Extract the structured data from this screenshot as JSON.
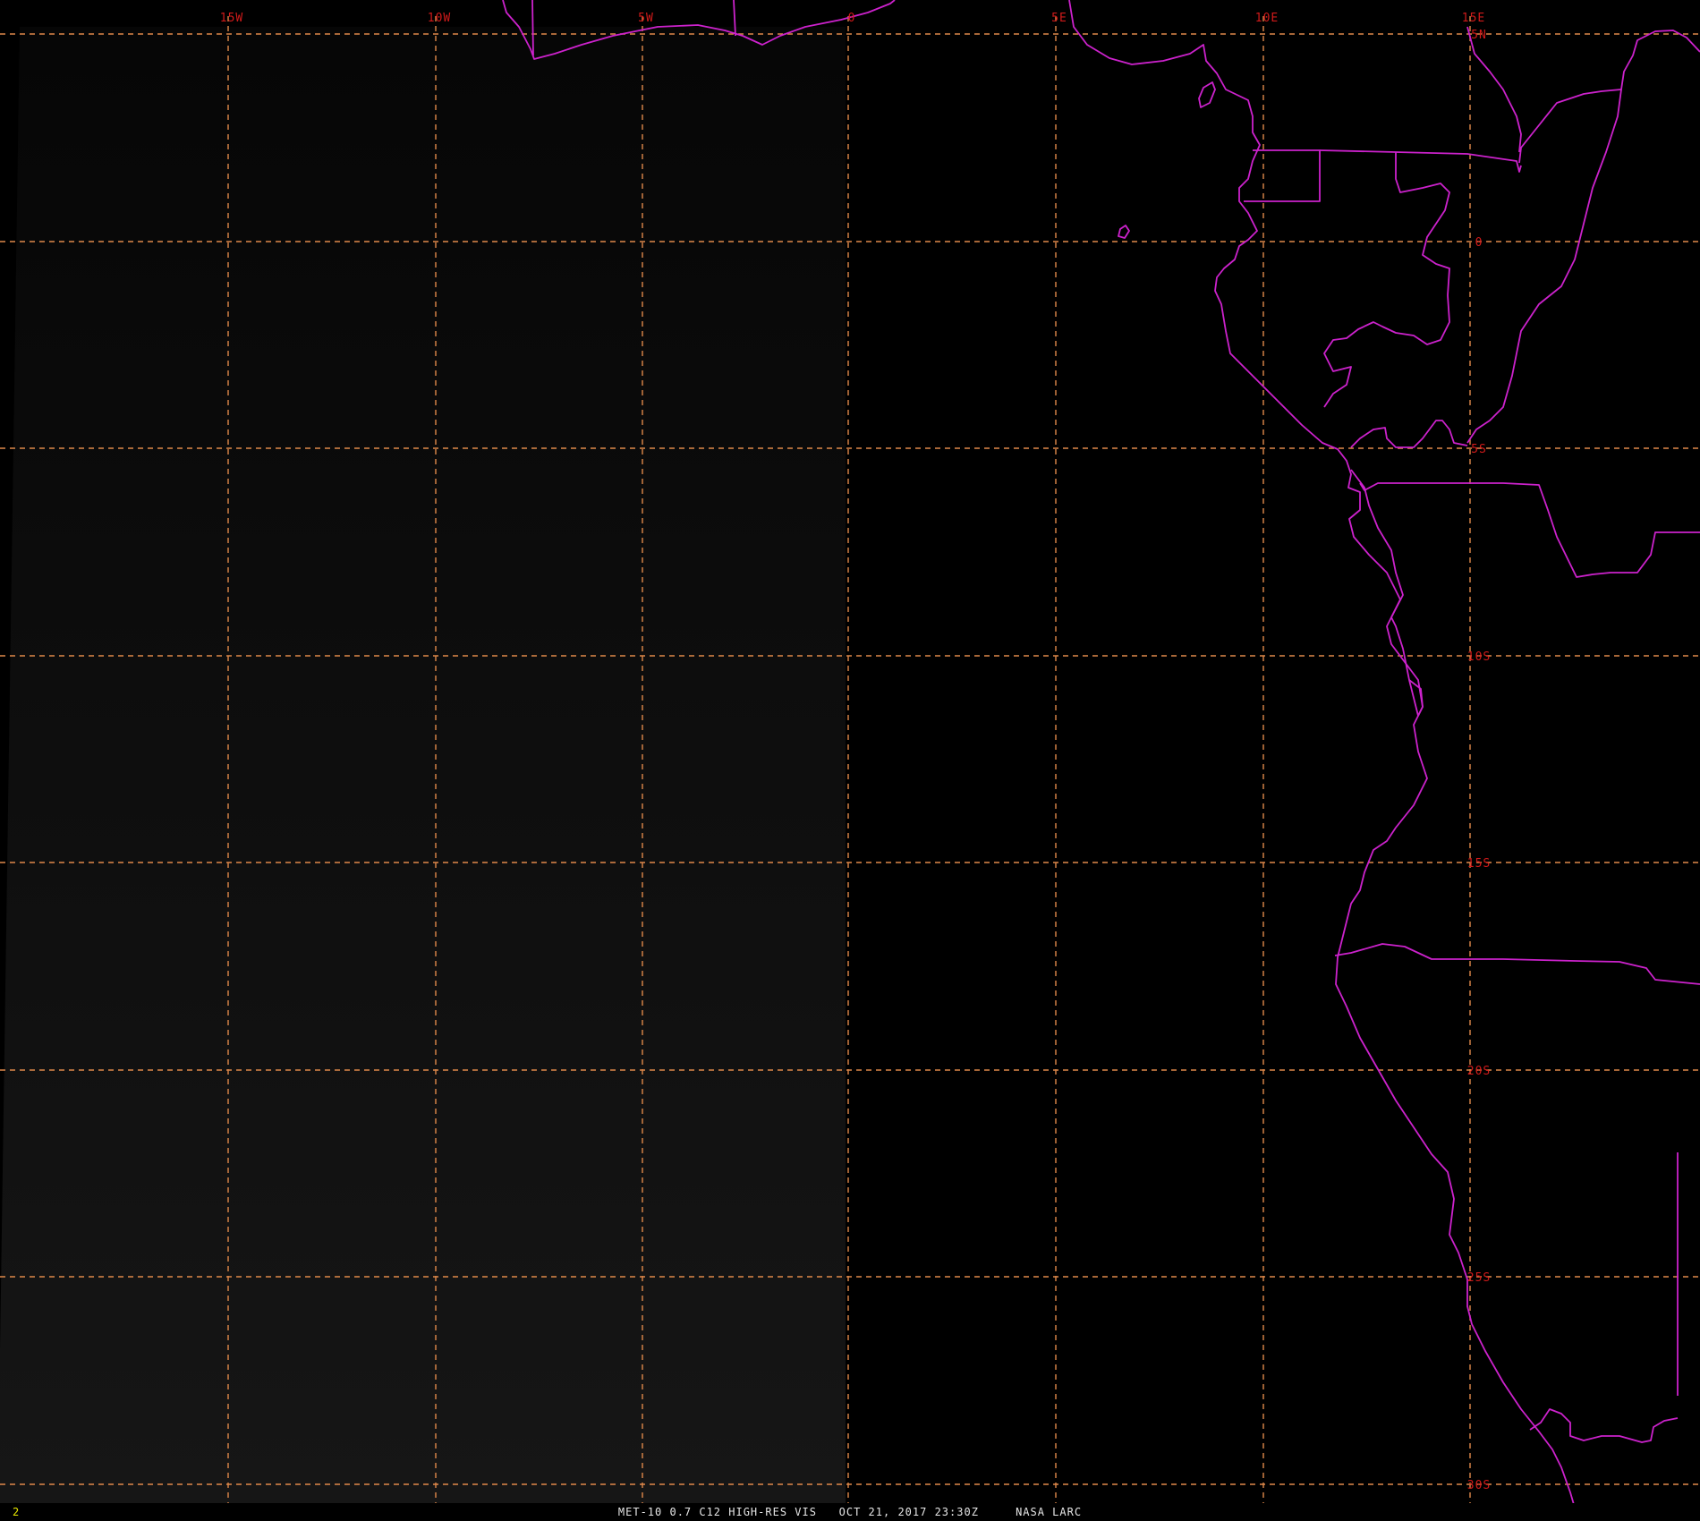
{
  "caption": {
    "frame_number": "2",
    "product": "MET-10 0.7 C12 HIGH-RES VIS",
    "datetime": "OCT 21, 2017 23:30Z",
    "source": "NASA LARC"
  },
  "grid": {
    "longitude_labels": [
      "15W",
      "10W",
      "5W",
      "0",
      "5E",
      "10E",
      "15E"
    ],
    "latitude_labels": [
      "5N",
      "0",
      "5S",
      "10S",
      "15S",
      "20S",
      "25S",
      "30S"
    ]
  },
  "colors": {
    "background": "#000000",
    "imagery_shade": "#0f0f0f",
    "gridline": "#e0894a",
    "grid_label": "#d11a1a",
    "coastline": "#cc22cc",
    "frame_number": "#e8e800",
    "caption_text": "#e6e6e6"
  }
}
